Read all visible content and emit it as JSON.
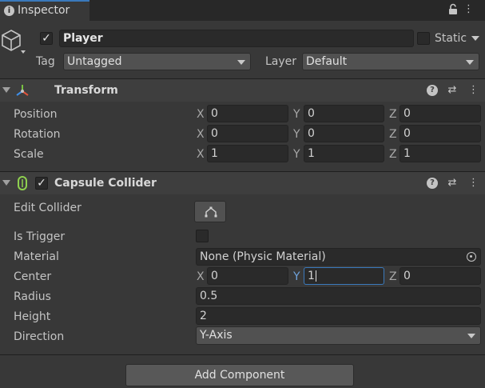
{
  "tab": {
    "label": "Inspector"
  },
  "header": {
    "name_value": "Player",
    "static_label": "Static",
    "tag_label": "Tag",
    "tag_value": "Untagged",
    "layer_label": "Layer",
    "layer_value": "Default"
  },
  "transform": {
    "title": "Transform",
    "rows": [
      {
        "label": "Position",
        "x": "0",
        "y": "0",
        "z": "0"
      },
      {
        "label": "Rotation",
        "x": "0",
        "y": "0",
        "z": "0"
      },
      {
        "label": "Scale",
        "x": "1",
        "y": "1",
        "z": "1"
      }
    ]
  },
  "axes": {
    "x": "X",
    "y": "Y",
    "z": "Z"
  },
  "collider": {
    "title": "Capsule Collider",
    "edit_label": "Edit Collider",
    "trigger_label": "Is Trigger",
    "material_label": "Material",
    "material_value": "None (Physic Material)",
    "center_label": "Center",
    "center": {
      "x": "0",
      "y": "1",
      "z": "0"
    },
    "radius_label": "Radius",
    "radius_value": "0.5",
    "height_label": "Height",
    "height_value": "2",
    "direction_label": "Direction",
    "direction_value": "Y-Axis"
  },
  "footer": {
    "add_component_label": "Add Component"
  },
  "colors": {
    "background": "#383838",
    "field": "#2a2a2a",
    "focus": "#3a79bb",
    "transform_icon_red": "#e0533b",
    "transform_icon_green": "#79c142",
    "transform_icon_blue": "#3f8fe8",
    "collider_icon": "#8fd14f"
  }
}
